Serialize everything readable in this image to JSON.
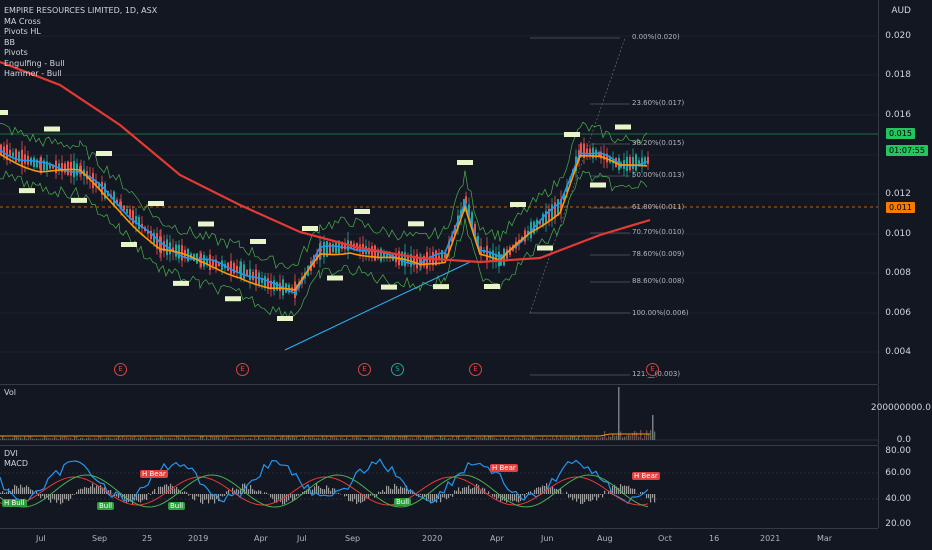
{
  "legend": {
    "symbol_title": "EMPIRE RESOURCES LIMITED, 1D, ASX",
    "indicators": [
      "MA Cross",
      "Pivots HL",
      "BB",
      "Pivots",
      "Engulfing - Bull",
      "Hammer - Bull"
    ]
  },
  "axis": {
    "currency": "AUD",
    "price_ticks": [
      "0.020",
      "0.018",
      "0.016",
      "0.014",
      "0.012",
      "0.010",
      "0.008",
      "0.006",
      "0.004"
    ],
    "last_price": "0.015",
    "countdown": "01:07:55",
    "level_tag": "0.011",
    "vol_ticks": [
      "200000000.0",
      "0.0"
    ],
    "osc_ticks": [
      "80.00",
      "60.00",
      "40.00",
      "20.00"
    ]
  },
  "fib": [
    {
      "label": "0.00%(0.020)"
    },
    {
      "label": "23.60%(0.017)"
    },
    {
      "label": "38.20%(0.015)"
    },
    {
      "label": "50.00%(0.013)"
    },
    {
      "label": "61.80%(0.011)"
    },
    {
      "label": "70.70%(0.010)"
    },
    {
      "label": "78.60%(0.009)"
    },
    {
      "label": "88.60%(0.008)"
    },
    {
      "label": "100.00%(0.006)"
    },
    {
      "label": "121.__(0.003)"
    }
  ],
  "events": [
    "E",
    "E",
    "E",
    "S",
    "E",
    "E"
  ],
  "vol_pane": {
    "title": "Vol"
  },
  "ind_pane": {
    "title1": "DVI",
    "title2": "MACD",
    "badges": [
      {
        "text": "H Bull",
        "type": "bull"
      },
      {
        "text": "H Bear",
        "type": "bear"
      },
      {
        "text": "Bull",
        "type": "bull"
      },
      {
        "text": "Bull",
        "type": "bull"
      },
      {
        "text": "H Bear",
        "type": "bear"
      },
      {
        "text": "Bull",
        "type": "bull"
      },
      {
        "text": "H Bear",
        "type": "bear"
      }
    ]
  },
  "x_labels": [
    "Jul",
    "Sep",
    "25",
    "2019",
    "Apr",
    "Jul",
    "Sep",
    "2020",
    "Apr",
    "Jun",
    "Aug",
    "Oct",
    "16",
    "2021",
    "Mar"
  ],
  "colors": {
    "background": "#131722",
    "up": "#26a69a",
    "down": "#ef5350",
    "ma_long": "#e53935",
    "ma_short": "#ff9800",
    "ma_fast": "#2196f3",
    "last_price": "#22c55e",
    "level": "#f57c00"
  }
}
